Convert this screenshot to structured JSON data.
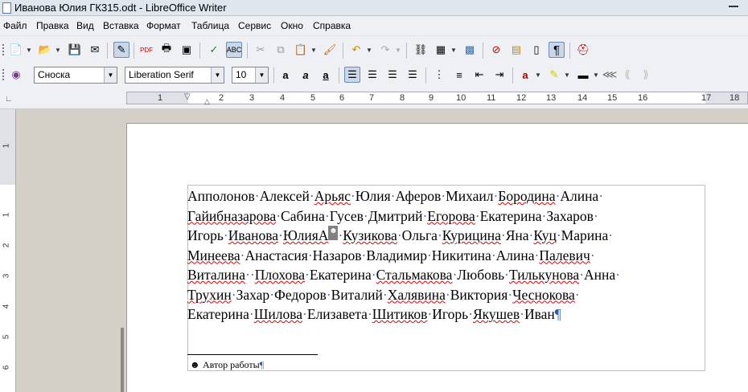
{
  "window": {
    "title": "Иванова Юлия ГК315.odt - LibreOffice Writer"
  },
  "menu": [
    "Файл",
    "Правка",
    "Вид",
    "Вставка",
    "Формат",
    "Таблица",
    "Сервис",
    "Окно",
    "Справка"
  ],
  "toolbar": {
    "paragraph_style": "Сноска",
    "font_name": "Liberation Serif",
    "font_size": "10"
  },
  "ruler": {
    "h_numbers": [
      "1",
      "1",
      "2",
      "3",
      "4",
      "5",
      "6",
      "7",
      "8",
      "9",
      "10",
      "11",
      "12",
      "13",
      "14",
      "15",
      "16",
      "17",
      "18"
    ],
    "v_numbers": [
      "1",
      "1",
      "2",
      "3",
      "4",
      "5",
      "6"
    ]
  },
  "document": {
    "lines": [
      [
        "Апполонов",
        "Алексей",
        "Арьяс",
        "Юлия",
        "Аферов",
        "Михаил",
        "Бородина",
        "Алина"
      ],
      [
        "Гайибназарова",
        "Сабина",
        "Гусев",
        "Дмитрий",
        "Егорова",
        "Екатерина",
        "Захаров"
      ],
      [
        "Игорь",
        "Иванова",
        "ЮлияА",
        "Кузикова",
        "Ольга",
        "Курицина",
        "Яна",
        "Куц",
        "Марина"
      ],
      [
        "Минеева",
        "Анастасия",
        "Назаров",
        "Владимир",
        "Никитина",
        "Алина",
        "Палевич"
      ],
      [
        "Виталина",
        "Плохова",
        "Екатерина",
        "Стальмакова",
        "Любовь",
        "Тилькунова",
        "Анна"
      ],
      [
        "Трухин",
        "Захар",
        "Федоров",
        "Виталий",
        "Халявина",
        "Виктория",
        "Чеснокова"
      ],
      [
        "Екатерина",
        "Шилова",
        "Елизавета",
        "Шитиков",
        "Игорь",
        "Якушев",
        "Иван"
      ]
    ],
    "footnote_anchor": "☻",
    "footnote_number": "☻",
    "footnote_text": "Автор работы",
    "pilcrow": "¶"
  }
}
